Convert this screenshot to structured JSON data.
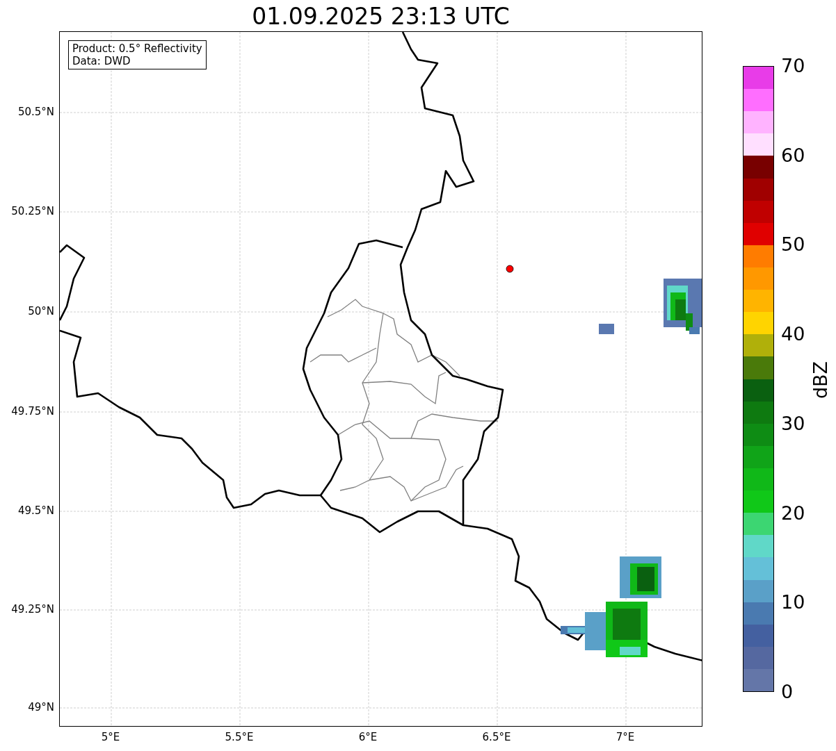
{
  "title": "01.09.2025 23:13 UTC",
  "info_box": [
    "Product: 0.5° Reflectivity",
    "Data: DWD"
  ],
  "lat_labels": [
    "50.5°N",
    "50.25°N",
    "50°N",
    "49.75°N",
    "49.5°N",
    "49.25°N",
    "49°N"
  ],
  "lon_labels": [
    "5°E",
    "5.5°E",
    "6°E",
    "6.5°E",
    "7°E"
  ],
  "marker": {
    "color": "#ff0000"
  },
  "colorbar": {
    "label": "dBZ",
    "ticks": [
      "70",
      "60",
      "50",
      "40",
      "30",
      "20",
      "10",
      "0"
    ],
    "bands": [
      {
        "color": "#e83ce8"
      },
      {
        "color": "#ff6eff"
      },
      {
        "color": "#ffb3ff"
      },
      {
        "color": "#ffdfff"
      },
      {
        "color": "#780000"
      },
      {
        "color": "#a00000"
      },
      {
        "color": "#c00000"
      },
      {
        "color": "#e00000"
      },
      {
        "color": "#ff7c00"
      },
      {
        "color": "#ff9800"
      },
      {
        "color": "#ffb400"
      },
      {
        "color": "#ffd400"
      },
      {
        "color": "#b0b00a"
      },
      {
        "color": "#4a7a0a"
      },
      {
        "color": "#0a6010"
      },
      {
        "color": "#0e7a10"
      },
      {
        "color": "#0e8c14"
      },
      {
        "color": "#10a418"
      },
      {
        "color": "#10b818"
      },
      {
        "color": "#10c818"
      },
      {
        "color": "#3cd672"
      },
      {
        "color": "#60d8c8"
      },
      {
        "color": "#64c0d8"
      },
      {
        "color": "#5aa0c8"
      },
      {
        "color": "#4a7ab0"
      },
      {
        "color": "#4460a0"
      },
      {
        "color": "#5568a0"
      },
      {
        "color": "#6476a8"
      }
    ]
  }
}
